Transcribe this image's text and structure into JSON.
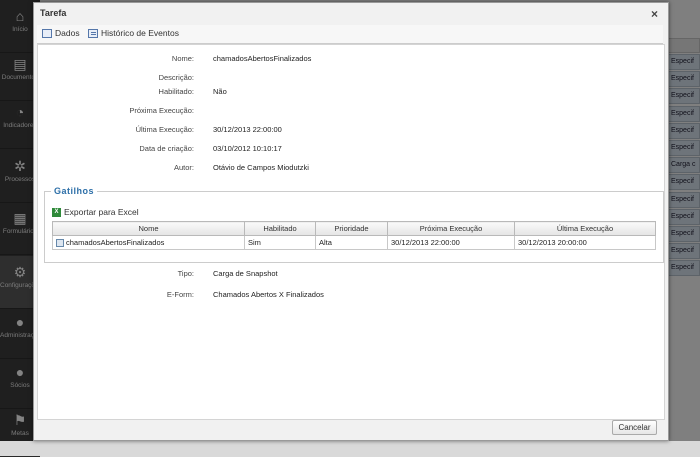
{
  "background": {
    "sidebar": [
      {
        "icon": "home-icon",
        "glyph": "⌂",
        "label": "Início"
      },
      {
        "icon": "document-icon",
        "glyph": "▤",
        "label": "Documentos"
      },
      {
        "icon": "pie-chart-icon",
        "glyph": "◔",
        "label": "Indicadores"
      },
      {
        "icon": "process-icon",
        "glyph": "✲",
        "label": "Processos"
      },
      {
        "icon": "form-icon",
        "glyph": "▦",
        "label": "Formulários"
      },
      {
        "icon": "gear-icon",
        "glyph": "⚙",
        "label": "Configurações"
      },
      {
        "icon": "user-icon",
        "glyph": "●",
        "label": "Administração"
      },
      {
        "icon": "users-icon",
        "glyph": "●",
        "label": "Sócios"
      },
      {
        "icon": "flag-icon",
        "glyph": "⚑",
        "label": "Metas"
      }
    ],
    "column_cells": [
      "Especif",
      "Especif",
      "Especif",
      "Especif",
      "Especif",
      "Especif",
      "Carga c",
      "Especif",
      "Especif",
      "Especif",
      "Especif",
      "Especif",
      "Especif"
    ]
  },
  "dialog": {
    "title": "Tarefa",
    "close_glyph": "×",
    "tabs": [
      {
        "label": "Dados"
      },
      {
        "label": "Histórico de Eventos"
      }
    ],
    "fields": [
      {
        "label": "Nome:",
        "value": "chamadosAbertosFinalizados"
      },
      {
        "label": "Descrição:",
        "value": ""
      },
      {
        "label": "Habilitado:",
        "value": "Não"
      },
      {
        "label": "Próxima Execução:",
        "value": ""
      },
      {
        "label": "Última Execução:",
        "value": "30/12/2013 22:00:00"
      },
      {
        "label": "Data de criação:",
        "value": "03/10/2012 10:10:17"
      },
      {
        "label": "Autor:",
        "value": "Otávio de Campos Miodutzki"
      }
    ],
    "gatilhos": {
      "legend": "Gatilhos",
      "export_label": "Exportar para Excel",
      "columns": [
        "Nome",
        "Habilitado",
        "Prioridade",
        "Próxima Execução",
        "Última Execução"
      ],
      "rows": [
        [
          "chamadosAbertosFinalizados",
          "Sim",
          "Alta",
          "30/12/2013 22:00:00",
          "30/12/2013 20:00:00"
        ]
      ]
    },
    "extra_fields": [
      {
        "label": "Tipo:",
        "value": "Carga de Snapshot"
      },
      {
        "label": "E-Form:",
        "value": "Chamados Abertos X Finalizados"
      }
    ],
    "cancel_label": "Cancelar"
  }
}
